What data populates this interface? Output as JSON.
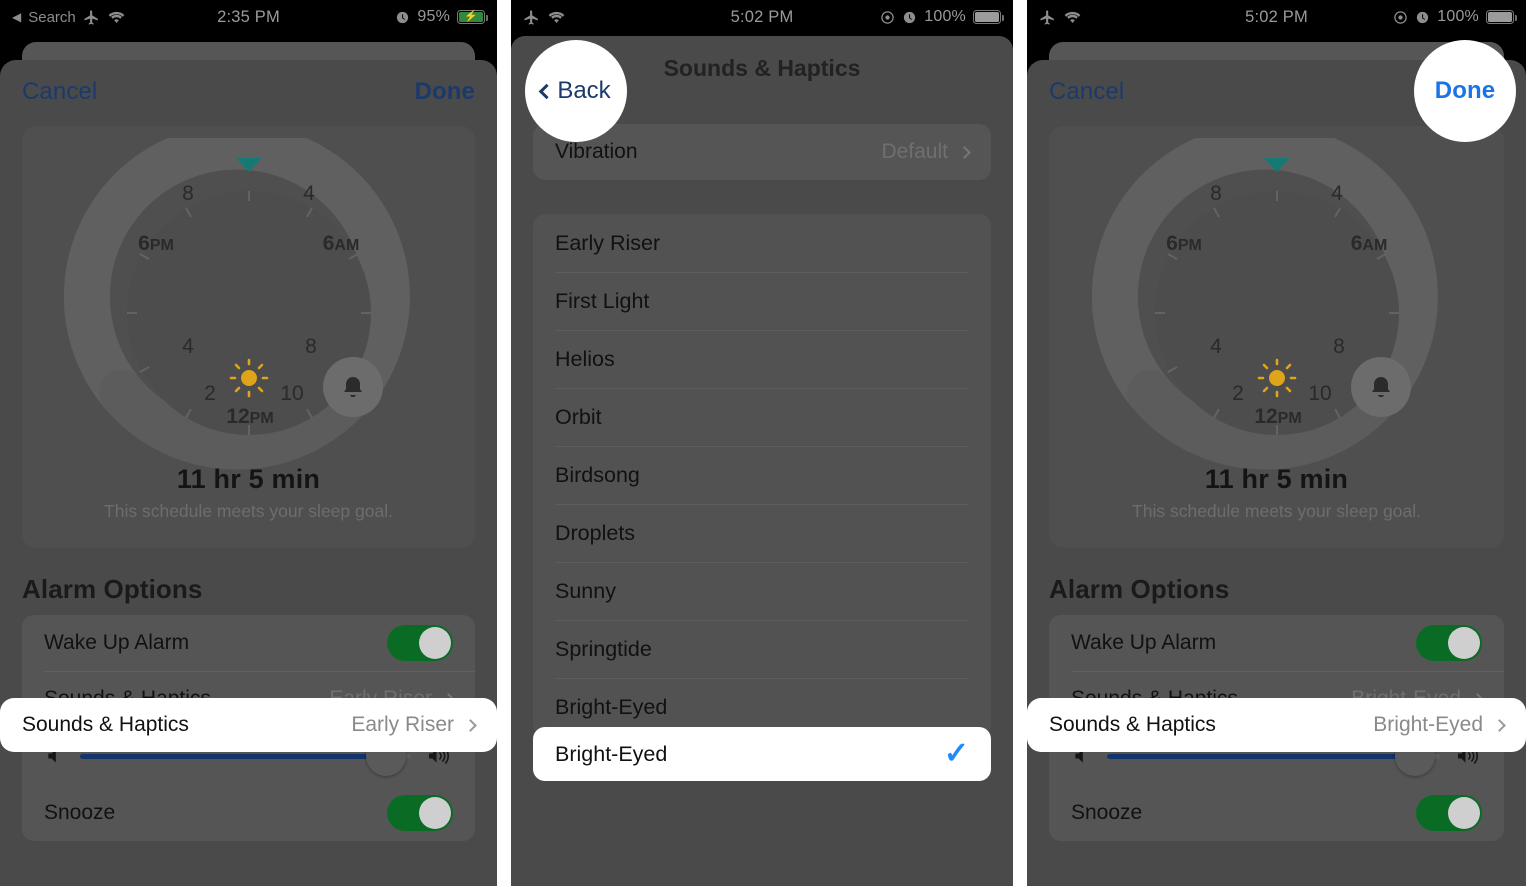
{
  "colors": {
    "accent_blue": "#1a8cff",
    "action_blue": "#1b3a6b",
    "toggle_green": "#0a6b24",
    "slider_blue": "#14346e",
    "sun_yellow": "#e0a41a",
    "wake_teal": "#167a74",
    "sheet_gray": "#4a4a4a",
    "highlight_white": "#ffffff"
  },
  "panels": [
    {
      "id": "panel-1",
      "status_bar": {
        "back_label": "Search",
        "back_icon": "triangle-left-icon",
        "icons": [
          "airplane-mode-icon",
          "wifi-icon"
        ],
        "time": "2:35 PM",
        "right_icons": [
          "alarm-clock-icon"
        ],
        "battery_percent": "95%",
        "battery_state": "charging"
      },
      "sheet": {
        "cancel_label": "Cancel",
        "done_label": "Done"
      },
      "sleep_card": {
        "duration": "11 hr 5 min",
        "subtitle": "This schedule meets your sleep goal.",
        "dial": {
          "labels_major": [
            "6PM",
            "6AM",
            "12PM"
          ],
          "labels_minor": [
            "8",
            "4",
            "4",
            "8",
            "2",
            "10"
          ],
          "bedtime_icon": "bed-marker-icon",
          "wake_icon": "bell-icon",
          "daylight_icon": "sun-icon"
        }
      },
      "alarm_options": {
        "title": "Alarm Options",
        "wake_up_alarm": {
          "label": "Wake Up Alarm",
          "value": "on"
        },
        "sounds_haptics": {
          "label": "Sounds & Haptics",
          "value": "Early Riser",
          "highlighted": true
        },
        "volume": {
          "left_icon": "speaker-low-icon",
          "right_icon": "speaker-high-icon",
          "percent": 88
        },
        "snooze": {
          "label": "Snooze",
          "value": "on"
        }
      }
    },
    {
      "id": "panel-2",
      "status_bar": {
        "back_label": "",
        "icons": [
          "airplane-mode-icon",
          "wifi-icon"
        ],
        "time": "5:02 PM",
        "right_icons": [
          "do-not-disturb-icon",
          "alarm-clock-icon"
        ],
        "battery_percent": "100%",
        "battery_state": "full"
      },
      "nav": {
        "back_label": "Back",
        "title": "Sounds & Haptics",
        "back_highlighted": true
      },
      "vibration": {
        "label": "Vibration",
        "value": "Default"
      },
      "sounds": [
        {
          "label": "Early Riser",
          "selected": false
        },
        {
          "label": "First Light",
          "selected": false
        },
        {
          "label": "Helios",
          "selected": false
        },
        {
          "label": "Orbit",
          "selected": false
        },
        {
          "label": "Birdsong",
          "selected": false
        },
        {
          "label": "Droplets",
          "selected": false
        },
        {
          "label": "Sunny",
          "selected": false
        },
        {
          "label": "Springtide",
          "selected": false
        },
        {
          "label": "Bright-Eyed",
          "selected": true
        }
      ],
      "check_glyph": "✓"
    },
    {
      "id": "panel-3",
      "status_bar": {
        "back_label": "",
        "icons": [
          "airplane-mode-icon",
          "wifi-icon"
        ],
        "time": "5:02 PM",
        "right_icons": [
          "do-not-disturb-icon",
          "alarm-clock-icon"
        ],
        "battery_percent": "100%",
        "battery_state": "full"
      },
      "sheet": {
        "cancel_label": "Cancel",
        "done_label": "Done",
        "done_highlighted": true
      },
      "sleep_card": {
        "duration": "11 hr 5 min",
        "subtitle": "This schedule meets your sleep goal.",
        "dial": {
          "labels_major": [
            "6PM",
            "6AM",
            "12PM"
          ],
          "labels_minor": [
            "8",
            "4",
            "4",
            "8",
            "2",
            "10"
          ],
          "bedtime_icon": "bed-marker-icon",
          "wake_icon": "bell-icon",
          "daylight_icon": "sun-icon"
        }
      },
      "alarm_options": {
        "title": "Alarm Options",
        "wake_up_alarm": {
          "label": "Wake Up Alarm",
          "value": "on"
        },
        "sounds_haptics": {
          "label": "Sounds & Haptics",
          "value": "Bright-Eyed",
          "highlighted": true
        },
        "volume": {
          "left_icon": "speaker-low-icon",
          "right_icon": "speaker-high-icon",
          "percent": 88
        },
        "snooze": {
          "label": "Snooze",
          "value": "on"
        }
      }
    }
  ]
}
